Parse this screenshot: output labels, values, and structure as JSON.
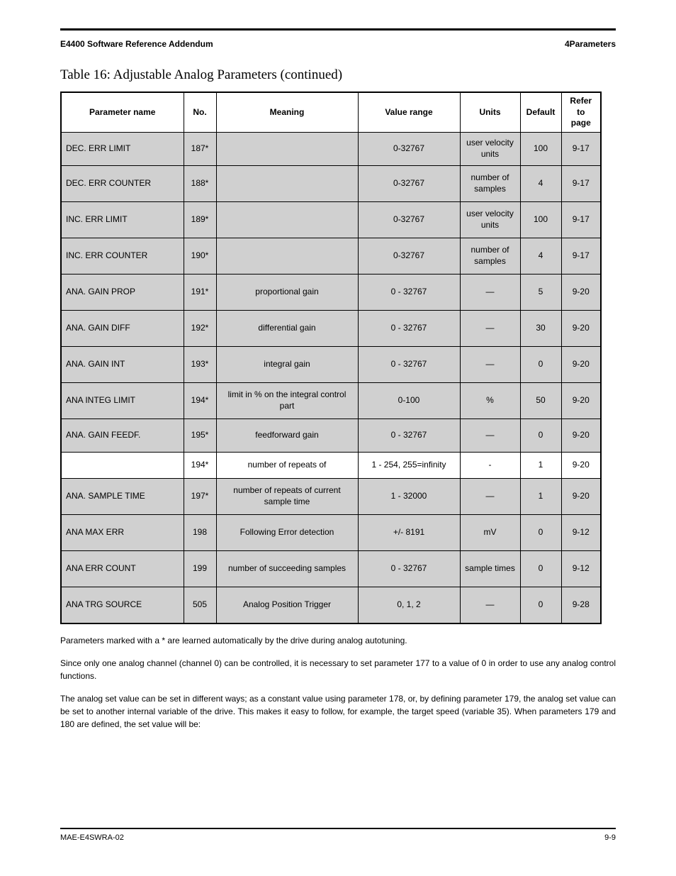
{
  "header": {
    "left": "E4400 Software Reference Addendum",
    "right": "4Parameters"
  },
  "subtitle": "Table 16: Adjustable Analog Parameters (continued)",
  "columns": {
    "c1": "Parameter name",
    "c2": "No.",
    "c3": "Meaning",
    "c4": "Value range",
    "c5": "Units",
    "c6": "Default",
    "c7": "Refer to page"
  },
  "rows": [
    {
      "name": "DEC. ERR LIMIT",
      "no": "187*",
      "meaning": "",
      "range": "0-32767",
      "units": "user velocity units",
      "def": "100",
      "page": "9-17"
    },
    {
      "name": "DEC. ERR COUNTER",
      "no": "188*",
      "meaning": "",
      "range": "0-32767",
      "units": "number of samples",
      "def": "4",
      "page": "9-17"
    },
    {
      "name": "INC. ERR LIMIT",
      "no": "189*",
      "meaning": "",
      "range": "0-32767",
      "units": "user velocity units",
      "def": "100",
      "page": "9-17"
    },
    {
      "name": "INC. ERR COUNTER",
      "no": "190*",
      "meaning": "",
      "range": "0-32767",
      "units": "number of samples",
      "def": "4",
      "page": "9-17"
    },
    {
      "name": "ANA. GAIN PROP",
      "no": "191*",
      "meaning": "proportional gain",
      "range": "0 - 32767",
      "units": "—",
      "def": "5",
      "page": "9-20"
    },
    {
      "name": "ANA. GAIN DIFF",
      "no": "192*",
      "meaning": "differential gain",
      "range": "0 - 32767",
      "units": "—",
      "def": "30",
      "page": "9-20"
    },
    {
      "name": "ANA. GAIN INT",
      "no": "193*",
      "meaning": "integral gain",
      "range": "0 - 32767",
      "units": "—",
      "def": "0",
      "page": "9-20"
    },
    {
      "name": "ANA INTEG LIMIT",
      "no": "194*",
      "meaning": "limit in % on the integral control part",
      "range": "0-100",
      "units": "%",
      "def": "50",
      "page": "9-20"
    },
    {
      "name": "ANA. GAIN FEEDF.",
      "no": "195*",
      "meaning": "feedforward gain",
      "range": "0 - 32767",
      "units": "—",
      "def": "0",
      "page": "9-20"
    },
    {
      "name": "",
      "no": "194*",
      "meaning": "number of repeats of",
      "range": "1 - 254, 255=infinity",
      "units": "-",
      "def": "1",
      "page": "9-20"
    },
    {
      "name": "ANA. SAMPLE TIME",
      "no": "197*",
      "meaning": "number of repeats of current sample time",
      "range": "1 - 32000",
      "units": "—",
      "def": "1",
      "page": "9-20"
    },
    {
      "name": "ANA MAX ERR",
      "no": "198",
      "meaning": "Following Error detection",
      "range": "+/- 8191",
      "units": "mV",
      "def": "0",
      "page": "9-12"
    },
    {
      "name": "ANA ERR COUNT",
      "no": "199",
      "meaning": "number of succeeding samples",
      "range": "0 - 32767",
      "units": "sample times",
      "def": "0",
      "page": "9-12"
    },
    {
      "name": "ANA TRG SOURCE",
      "no": "505",
      "meaning": "Analog Position Trigger",
      "range": "0, 1, 2",
      "units": "—",
      "def": "0",
      "page": "9-28"
    }
  ],
  "para": {
    "p1": "Parameters marked with a * are learned automatically by the drive during analog autotuning.",
    "p2": "Since only one analog channel (channel 0) can be controlled, it is necessary to set parameter 177 to a value of 0 in order to use any analog control functions.",
    "p3": "The analog set value can be set in different ways; as a constant value using parameter 178, or, by defining parameter 179, the analog set value can be set to another internal variable of the drive. This makes it easy to follow, for example, the target speed (variable 35). When parameters 179 and 180 are defined, the set value will be:"
  },
  "footer": {
    "left": "MAE-E4SWRA-02",
    "right": "9-9"
  }
}
